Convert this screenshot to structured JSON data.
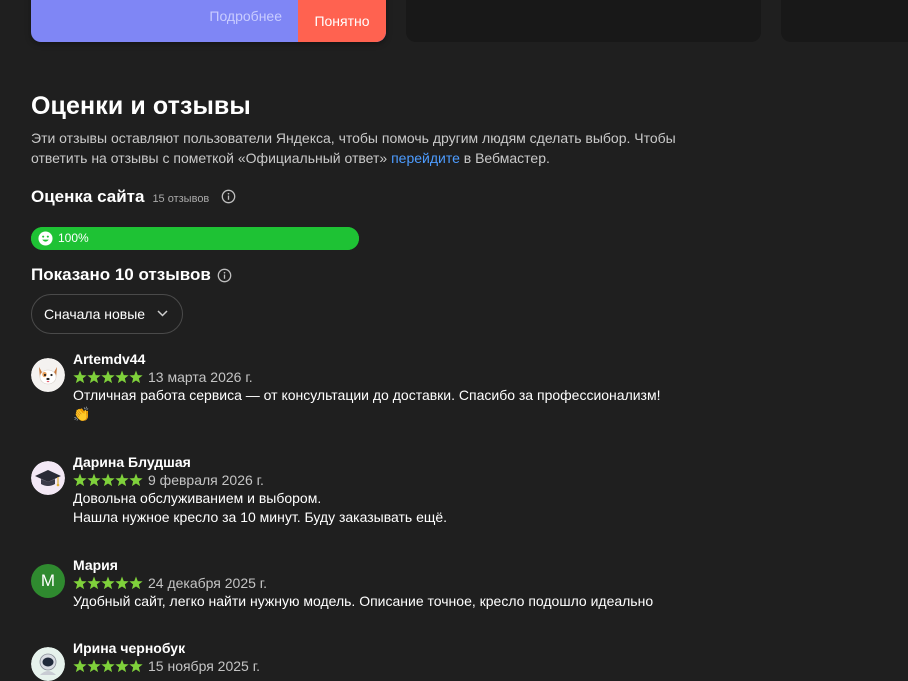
{
  "promo": {
    "more_label": "Подробнее",
    "ok_label": "Понятно"
  },
  "section": {
    "title": "Оценки и отзывы",
    "desc_before": "Эти отзывы оставляют пользователи Яндекса, чтобы помочь другим людям сделать выбор. Чтобы ответить на отзывы с пометкой «Официальный ответ» ",
    "desc_link": "перейдите",
    "desc_after": " в Вебмастер."
  },
  "rating": {
    "title": "Оценка сайта",
    "count": "15 отзывов",
    "percent_label": "100%",
    "percent_value": 100
  },
  "shown": {
    "title": "Показано 10 отзывов"
  },
  "sort": {
    "selected": "Сначала новые"
  },
  "colors": {
    "background": "#1f1f1f",
    "promo": "#7f86f5",
    "accent_button": "#ff6250",
    "rating_bar": "#1ec234",
    "stars": "#7fd13b",
    "link": "#4d9cff"
  },
  "reviews": [
    {
      "author": "Artemdv44",
      "rating": 5,
      "date": "13 марта 2026 г.",
      "lines": [
        "Отличная работа сервиса — от консультации до доставки. Спасибо за профессионализм!",
        "👏"
      ],
      "avatar": "dog-avatar-icon"
    },
    {
      "author": "Дарина Блудшая",
      "rating": 5,
      "date": "9 февраля 2026 г.",
      "lines": [
        "Довольна обслуживанием и выбором.",
        "Нашла нужное кресло за 10 минут. Буду заказывать ещё."
      ],
      "avatar": "graduation-cap-avatar-icon"
    },
    {
      "author": "Мария",
      "rating": 5,
      "date": "24 декабря 2025 г.",
      "lines": [
        "Удобный сайт, легко найти нужную модель. Описание точное, кресло подошло идеально"
      ],
      "avatar_letter": "М"
    },
    {
      "author": "Ирина чернобук",
      "rating": 5,
      "date": "15 ноября 2025 г.",
      "lines": [],
      "avatar": "astronaut-avatar-icon"
    }
  ]
}
